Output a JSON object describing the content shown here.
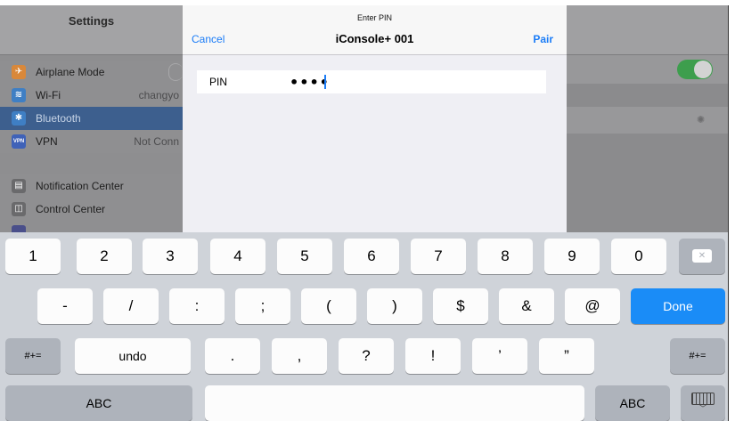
{
  "sidebar": {
    "title": "Settings",
    "items": [
      {
        "icon": "airplane-icon",
        "icon_glyph": "✈",
        "icon_color": "#d9883a",
        "label": "Airplane Mode",
        "value": ""
      },
      {
        "icon": "wifi-icon",
        "icon_glyph": "≋",
        "icon_color": "#3f7fc4",
        "label": "Wi-Fi",
        "value": "changyo"
      },
      {
        "icon": "bluetooth-icon",
        "icon_glyph": "✱",
        "icon_color": "#3f7fc4",
        "label": "Bluetooth",
        "value": ""
      },
      {
        "icon": "vpn-icon",
        "icon_glyph": "VPN",
        "icon_color": "#3f62b8",
        "label": "VPN",
        "value": "Not Conn"
      },
      {
        "icon": "notification-center-icon",
        "icon_glyph": "▤",
        "icon_color": "#6a6a6c",
        "label": "Notification Center",
        "value": ""
      },
      {
        "icon": "control-center-icon",
        "icon_glyph": "◫",
        "icon_color": "#6a6a6c",
        "label": "Control Center",
        "value": ""
      }
    ]
  },
  "detail": {
    "toggle_on": true,
    "toggle_color": "#3d9e4d"
  },
  "modal": {
    "prompt": "Enter PIN",
    "title": "iConsole+ 001",
    "cancel_label": "Cancel",
    "pair_label": "Pair",
    "pin_label": "PIN",
    "pin_value": "••••",
    "accent_color": "#1a7cf7"
  },
  "keyboard": {
    "row1": [
      "1",
      "2",
      "3",
      "4",
      "5",
      "6",
      "7",
      "8",
      "9",
      "0"
    ],
    "row2": [
      "-",
      "/",
      ":",
      ";",
      "(",
      ")",
      "$",
      "&",
      "@"
    ],
    "row3_left": "#+=",
    "row3_undo": "undo",
    "row3": [
      ".",
      ",",
      "?",
      "!",
      "’",
      "”"
    ],
    "row3_right": "#+=",
    "done_label": "Done",
    "abc_left": "ABC",
    "abc_right": "ABC",
    "backspace_icon": "backspace-icon",
    "hide_keyboard_icon": "keyboard-hide-icon"
  }
}
